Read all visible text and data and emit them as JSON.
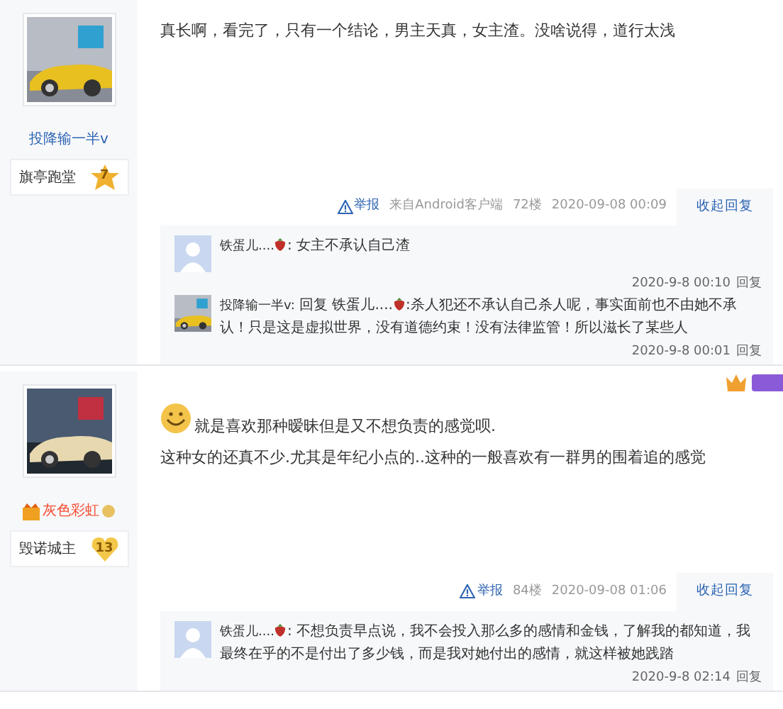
{
  "posts": [
    {
      "author": {
        "name": "投降输一半v",
        "vip": false
      },
      "badge": {
        "title": "旗亭跑堂",
        "level": "7",
        "kind": "star"
      },
      "emoticon": false,
      "content": [
        "真长啊，看完了，只有一个结论，男主天真，女主渣。没啥说得，道行太浅"
      ],
      "tail": {
        "report": "举报",
        "source": "来自Android客户端",
        "floor": "72楼",
        "time": "2020-09-08 00:09",
        "toggle": "收起回复"
      },
      "replies": [
        {
          "avatar": {
            "kind": "placeholder"
          },
          "author": "铁蛋儿....",
          "text": ": 女主不承认自己渣",
          "time": "2020-9-8 00:10",
          "action": "回复"
        },
        {
          "author": "投降输一半v:",
          "reply_label": "回复",
          "reply_to": "铁蛋儿....",
          "text": ":杀人犯还不承认自己杀人呢，事实面前也不由她不承认！只是这是虚拟世界，没有道德约束！没有法律监管！所以滋长了某些人",
          "time": "2020-9-8 00:01",
          "action": "回复"
        }
      ]
    },
    {
      "author": {
        "name": "灰色彩虹",
        "vip": true
      },
      "badge": {
        "title": "毁诺城主",
        "level": "13",
        "kind": "heart"
      },
      "emoticon": true,
      "content": [
        "就是喜欢那种暧昧但是又不想负责的感觉呗.",
        "这种女的还真不少.尤其是年纪小点的..这种的一般喜欢有一群男的围着追的感觉"
      ],
      "tail": {
        "report": "举报",
        "floor": "84楼",
        "time": "2020-09-08 01:06",
        "toggle": "收起回复"
      },
      "replies": [
        {
          "avatar": {
            "kind": "placeholder"
          },
          "author": "铁蛋儿....",
          "text": ": 不想负责早点说，我不会投入那么多的感情和金钱，了解我的都知道，我最终在乎的不是付出了多少钱，而是我对她付出的感情，就这样被她践踏",
          "time": "2020-9-8 02:14",
          "action": "回复"
        }
      ]
    }
  ]
}
